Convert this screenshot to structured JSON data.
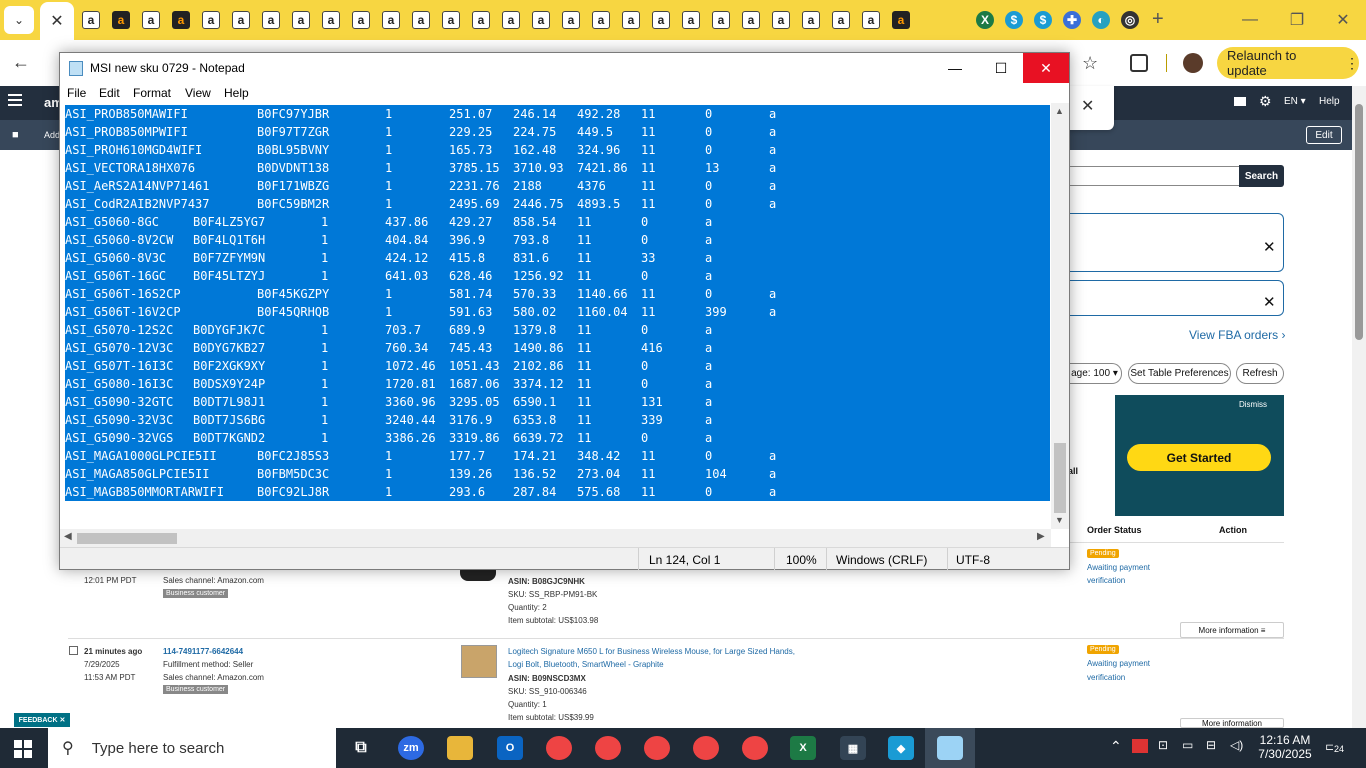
{
  "browser": {
    "tab_count_icons": 28,
    "relaunch_label": "Relaunch to update"
  },
  "amazon": {
    "lang": "EN",
    "help": "Help",
    "edit": "Edit",
    "search": "Search",
    "view_fba": "View FBA orders",
    "page_size": "age: 100",
    "table_prefs": "Set Table Preferences",
    "refresh": "Refresh",
    "dismiss": "Dismiss",
    "get_started": "Get Started",
    "col_order_status": "Order Status",
    "col_action": "Action",
    "orders": [
      {
        "time": "12:01 PM PDT",
        "channel": "Sales channel: Amazon.com",
        "biz": "Business customer",
        "asin": "ASIN: B08GJC9NHK",
        "sku": "SKU: SS_RBP-PM91-BK",
        "qty": "Quantity: 2",
        "subtotal": "Item subtotal: US$103.98",
        "status": "Pending",
        "status2": "Awaiting payment",
        "status3": "verification",
        "more": "More information"
      },
      {
        "ago": "21 minutes ago",
        "date": "7/29/2025",
        "time": "11:53 AM PDT",
        "order_id": "114-7491177-6642644",
        "fulfill": "Fulfillment method: Seller",
        "channel": "Sales channel: Amazon.com",
        "biz": "Business customer",
        "product": "Logitech Signature M650 L for Business Wireless Mouse, for Large Sized Hands,",
        "product2": "Logi Bolt, Bluetooth, SmartWheel - Graphite",
        "asin": "ASIN: B09NSCD3MX",
        "sku": "SKU: SS_910-006346",
        "qty": "Quantity: 1",
        "subtotal": "Item subtotal: US$39.99",
        "status": "Pending",
        "status2": "Awaiting payment",
        "status3": "verification",
        "more": "More information"
      }
    ],
    "feedback": "FEEDBACK"
  },
  "notepad": {
    "title": "MSI new sku 0729 - Notepad",
    "menu": [
      "File",
      "Edit",
      "Format",
      "View",
      "Help"
    ],
    "rows": [
      [
        "ASI_PROB850MAWIFI",
        "B0FC97YJBR",
        "1",
        "251.07",
        "246.14",
        "492.28",
        "11",
        "0",
        "a"
      ],
      [
        "ASI_PROB850MPWIFI",
        "B0F97T7ZGR",
        "1",
        "229.25",
        "224.75",
        "449.5",
        "11",
        "0",
        "a"
      ],
      [
        "ASI_PROH610MGD4WIFI",
        "B0BL95BVNY",
        "1",
        "165.73",
        "162.48",
        "324.96",
        "11",
        "0",
        "a"
      ],
      [
        "ASI_VECTORA18HX076",
        "B0DVDNT138",
        "1",
        "3785.15",
        "3710.93",
        "7421.86",
        "11",
        "13",
        "a"
      ],
      [
        "ASI_AeRS2A14NVP71461",
        "B0F171WBZG",
        "1",
        "2231.76",
        "2188",
        "4376",
        "11",
        "0",
        "a"
      ],
      [
        "ASI_CodR2AIB2NVP7437",
        "B0FC59BM2R",
        "1",
        "2495.69",
        "2446.75",
        "4893.5",
        "11",
        "0",
        "a"
      ],
      [
        "ASI_G5060-8GC",
        "B0F4LZ5YG7",
        "1",
        "437.86",
        "429.27",
        "858.54",
        "11",
        "0",
        "a"
      ],
      [
        "ASI_G5060-8V2CW",
        "B0F4LQ1T6H",
        "1",
        "404.84",
        "396.9",
        "793.8",
        "11",
        "0",
        "a"
      ],
      [
        "ASI_G5060-8V3C",
        "B0F7ZFYM9N",
        "1",
        "424.12",
        "415.8",
        "831.6",
        "11",
        "33",
        "a"
      ],
      [
        "ASI_G506T-16GC",
        "B0F45LTZYJ",
        "1",
        "641.03",
        "628.46",
        "1256.92",
        "11",
        "0",
        "a"
      ],
      [
        "ASI_G506T-16S2CP",
        "B0F45KGZPY",
        "1",
        "581.74",
        "570.33",
        "1140.66",
        "11",
        "0",
        "a"
      ],
      [
        "ASI_G506T-16V2CP",
        "B0F45QRHQB",
        "1",
        "591.63",
        "580.02",
        "1160.04",
        "11",
        "399",
        "a"
      ],
      [
        "ASI_G5070-12S2C",
        "B0DYGFJK7C",
        "1",
        "703.7",
        "689.9",
        "1379.8",
        "11",
        "0",
        "a"
      ],
      [
        "ASI_G5070-12V3C",
        "B0DYG7KB27",
        "1",
        "760.34",
        "745.43",
        "1490.86",
        "11",
        "416",
        "a"
      ],
      [
        "ASI_G507T-16I3C",
        "B0F2XGK9XY",
        "1",
        "1072.46",
        "1051.43",
        "2102.86",
        "11",
        "0",
        "a"
      ],
      [
        "ASI_G5080-16I3C",
        "B0DSX9Y24P",
        "1",
        "1720.81",
        "1687.06",
        "3374.12",
        "11",
        "0",
        "a"
      ],
      [
        "ASI_G5090-32GTC",
        "B0DT7L98J1",
        "1",
        "3360.96",
        "3295.05",
        "6590.1",
        "11",
        "131",
        "a"
      ],
      [
        "ASI_G5090-32V3C",
        "B0DT7JS6BG",
        "1",
        "3240.44",
        "3176.9",
        "6353.8",
        "11",
        "339",
        "a"
      ],
      [
        "ASI_G5090-32VGS",
        "B0DT7KGND2",
        "1",
        "3386.26",
        "3319.86",
        "6639.72",
        "11",
        "0",
        "a"
      ],
      [
        "ASI_MAGA1000GLPCIE5II",
        "B0FC2J85S3",
        "1",
        "177.7",
        "174.21",
        "348.42",
        "11",
        "0",
        "a"
      ],
      [
        "ASI_MAGA850GLPCIE5II",
        "B0FBM5DC3C",
        "1",
        "139.26",
        "136.52",
        "273.04",
        "11",
        "104",
        "a"
      ],
      [
        "ASI_MAGB850MMORTARWIFI",
        "B0FC92LJ8R",
        "1",
        "293.6",
        "287.84",
        "575.68",
        "11",
        "0",
        "a"
      ]
    ],
    "status_pos": "Ln 124, Col 1",
    "status_zoom": "100%",
    "status_eol": "Windows (CRLF)",
    "status_enc": "UTF-8"
  },
  "taskbar": {
    "search_placeholder": "Type here to search",
    "time": "12:16 AM",
    "date": "7/30/2025",
    "notif_count": "24"
  }
}
